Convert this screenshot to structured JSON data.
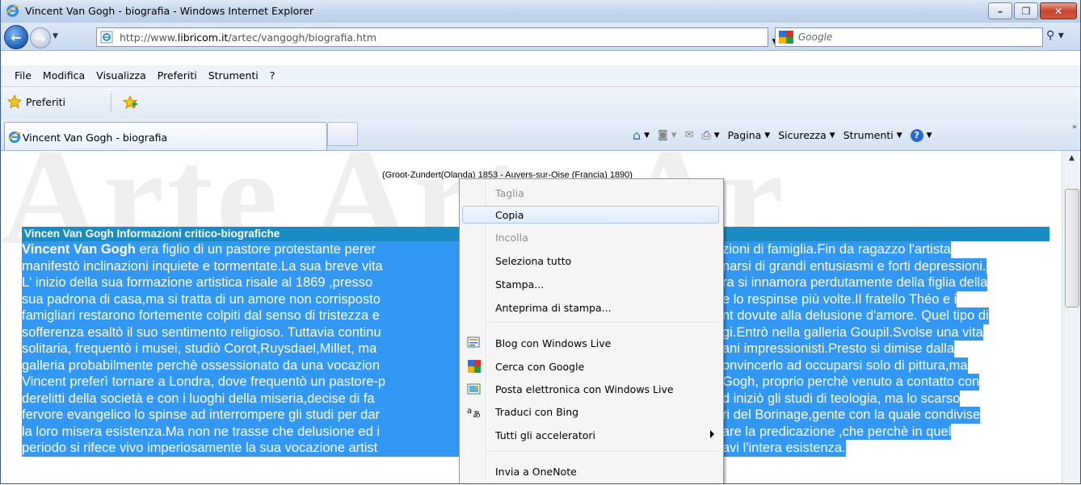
{
  "window": {
    "title": "Vincent Van Gogh - biografia - Windows Internet Explorer",
    "buttons": {
      "minimize": "–",
      "maximize": "❐",
      "close": "✕"
    }
  },
  "address": {
    "url_prefix": "http://www.",
    "url_domain": "libricom.it",
    "url_path": "/artec/vangogh/biografia.htm",
    "search_placeholder": "Google"
  },
  "menu": [
    "File",
    "Modifica",
    "Visualizza",
    "Preferiti",
    "Strumenti",
    "?"
  ],
  "favorites": {
    "label": "Preferiti"
  },
  "tab": {
    "title": "Vincent Van Gogh - biografia"
  },
  "command_bar": {
    "page": "Pagina",
    "security": "Sicurezza",
    "tools": "Strumenti"
  },
  "page": {
    "watermark": "Arte Arte Ar",
    "subtitle": "(Groot-Zundert(Olanda) 1853 - Auvers-sur-Oise (Francia) 1890)",
    "section_title": "Vincen Van Gogh Informazioni critico-biografiche",
    "bio_lead": "Vincent Van Gogh",
    "bio_lines": [
      [
        " era figlio di un pastore protestante perer",
        "zioni di famiglia.Fin da ragazzo l'artista"
      ],
      [
        "manifestò inclinazioni inquiete e tormentate.La sua breve vita",
        "narsi di grandi entusiasmi e forti depressioni."
      ],
      [
        "L' inizio della sua formazione artistica risale al 1869 ,presso",
        "ra si innamora perdutamente della figlia della"
      ],
      [
        "sua padrona di casa,ma si tratta di un amore non corrisposto",
        "e lo respinse più volte.Il fratello Théo e i"
      ],
      [
        "famigliari restarono fortemente colpiti dal senso di tristezza e",
        "nt dovute alla delusione d'amore. Quel tipo di"
      ],
      [
        "sofferenza esaltò il suo sentimento religioso. Tuttavia continu",
        "gi.Entrò nella galleria Goupil.Svolse una vita"
      ],
      [
        "solitaria, frequentò i musei, studiò Corot,Ruysdael,Millet, ma",
        "ani impressionisti.Presto si dimise dalla"
      ],
      [
        "galleria probabilmente perchè ossessionato da una vocazion",
        "onvincerlo ad occuparsi solo di pittura,ma"
      ],
      [
        "Vincent preferì tornare a Londra, dove frequentò un pastore-p",
        "Gogh, proprio perchè venuto a contatto con"
      ],
      [
        "derelitti della società e con i luoghi della miseria,decise di fa",
        "d iniziò gli studi di teologia, ma lo scarso"
      ],
      [
        "fervore evangelico lo spinse ad interrompere gli studi per dar",
        "ri del Borinage,gente con la quale condivise"
      ],
      [
        "la loro misera esistenza.Ma non ne trasse che delusione ed i",
        "are la predicazione ,che perchè in quel"
      ],
      [
        "periodo si rifece vivo imperiosamente la sua vocazione artist",
        "avi l'intera esistenza."
      ]
    ]
  },
  "context_menu": {
    "items": [
      {
        "label": "Taglia",
        "enabled": false,
        "icon": ""
      },
      {
        "label": "Copia",
        "enabled": true,
        "icon": "",
        "hover": true
      },
      {
        "label": "Incolla",
        "enabled": false,
        "icon": ""
      },
      {
        "label": "Seleziona tutto",
        "enabled": true,
        "icon": ""
      },
      {
        "label": "Stampa...",
        "enabled": true,
        "icon": ""
      },
      {
        "label": "Anteprima di stampa...",
        "enabled": true,
        "icon": ""
      },
      {
        "label": "Blog con Windows Live",
        "enabled": true,
        "icon": "blog-icon"
      },
      {
        "label": "Cerca con Google",
        "enabled": true,
        "icon": "google-icon"
      },
      {
        "label": "Posta elettronica con Windows Live",
        "enabled": true,
        "icon": "mail-icon"
      },
      {
        "label": "Traduci con Bing",
        "enabled": true,
        "icon": "translate-icon"
      },
      {
        "label": "Tutti gli acceleratori",
        "enabled": true,
        "icon": "",
        "submenu": true
      },
      {
        "label": "Invia a OneNote",
        "enabled": true,
        "icon": ""
      }
    ]
  },
  "colors": {
    "selection": "#3398f3",
    "header_bar": "#1a8bc3"
  }
}
